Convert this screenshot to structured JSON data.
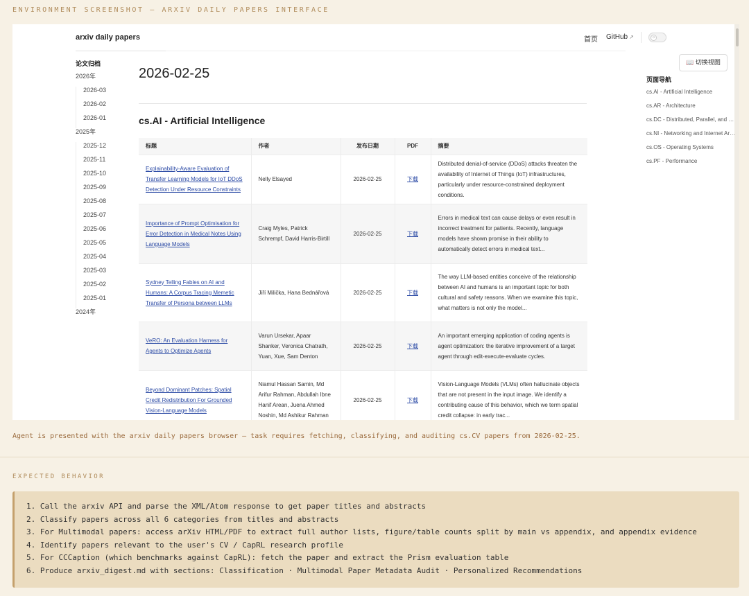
{
  "env_label": "ENVIRONMENT SCREENSHOT — ARXIV DAILY PAPERS INTERFACE",
  "header": {
    "app_title": "arxiv daily papers",
    "nav_home": "首页",
    "nav_github": "GitHub",
    "github_icon": "external-link-icon",
    "theme_icon": "sun-icon"
  },
  "sidebar": {
    "heading": "论文归档",
    "years": [
      {
        "label": "2026年",
        "months": [
          "2026-03",
          "2026-02",
          "2026-01"
        ]
      },
      {
        "label": "2025年",
        "months": [
          "2025-12",
          "2025-11",
          "2025-10",
          "2025-09",
          "2025-08",
          "2025-07",
          "2025-06",
          "2025-05",
          "2025-04",
          "2025-03",
          "2025-02",
          "2025-01"
        ]
      },
      {
        "label": "2024年",
        "months": []
      }
    ]
  },
  "main": {
    "date": "2026-02-25",
    "category_title": "cs.AI - Artificial Intelligence",
    "columns": [
      "标题",
      "作者",
      "发布日期",
      "PDF",
      "摘要"
    ],
    "rows": [
      {
        "title": "Explainability-Aware Evaluation of Transfer Learning Models for IoT DDoS Detection Under Resource Constraints",
        "authors": "Nelly Elsayed",
        "date": "2026-02-25",
        "pdf": "下载",
        "abstract": "Distributed denial-of-service (DDoS) attacks threaten the availability of Internet of Things (IoT) infrastructures, particularly under resource-constrained deployment conditions."
      },
      {
        "title": "Importance of Prompt Optimisation for Error Detection in Medical Notes Using Language Models",
        "authors": "Craig Myles, Patrick Schrempf, David Harris-Birtill",
        "date": "2026-02-25",
        "pdf": "下载",
        "abstract": "Errors in medical text can cause delays or even result in incorrect treatment for patients. Recently, language models have shown promise in their ability to automatically detect errors in medical text..."
      },
      {
        "title": "Sydney Telling Fables on AI and Humans: A Corpus Tracing Memetic Transfer of Persona between LLMs",
        "authors": "Jiří Milička, Hana Bednářová",
        "date": "2026-02-25",
        "pdf": "下载",
        "abstract": "The way LLM-based entities conceive of the relationship between AI and humans is an important topic for both cultural and safety reasons. When we examine this topic, what matters is not only the model..."
      },
      {
        "title": "VeRO: An Evaluation Harness for Agents to Optimize Agents",
        "authors": "Varun Ursekar, Apaar Shanker, Veronica Chatrath, Yuan, Xue, Sam Denton",
        "date": "2026-02-25",
        "pdf": "下载",
        "abstract": "An important emerging application of coding agents is agent optimization: the iterative improvement of a target agent through edit-execute-evaluate cycles."
      },
      {
        "title": "Beyond Dominant Patches: Spatial Credit Redistribution For Grounded Vision-Language Models",
        "authors": "Niamul Hassan Samin, Md Arifur Rahman, Abdullah Ibne Hanif Arean, Juena Ahmed Noshin, Md Ashikur Rahman",
        "date": "2026-02-25",
        "pdf": "下载",
        "abstract": "Vision-Language Models (VLMs) often hallucinate objects that are not present in the input image. We identify a contributing cause of this behavior, which we term spatial credit collapse: in early trac..."
      }
    ]
  },
  "right_panel": {
    "switch_view": "切换视图",
    "switch_icon": "book-icon",
    "toc_heading": "页面导航",
    "toc_items": [
      "cs.AI - Artificial Intelligence",
      "cs.AR - Architecture",
      "cs.DC - Distributed, Parallel, and Cluster Computing",
      "cs.NI - Networking and Internet Architecture",
      "cs.OS - Operating Systems",
      "cs.PF - Performance"
    ]
  },
  "caption": "Agent is presented with the arxiv daily papers browser — task requires fetching, classifying, and auditing cs.CV papers from 2026-02-25.",
  "expected": {
    "label": "EXPECTED BEHAVIOR",
    "steps": [
      "1. Call the arxiv API and parse the XML/Atom response to get paper titles and abstracts",
      "2. Classify papers across all 6 categories from titles and abstracts",
      "3. For Multimodal papers: access arXiv HTML/PDF to extract full author lists, figure/table counts split by main vs appendix, and appendix evidence",
      "4. Identify papers relevant to the user's CV / CapRL research profile",
      "5. For CCCaption (which benchmarks against CapRL): fetch the paper and extract the Prism evaluation table",
      "6. Produce arxiv_digest.md with sections: Classification · Multimodal Paper Metadata Audit · Personalized Recommendations"
    ]
  },
  "colors": {
    "page_bg": "#f7f1e5",
    "accent_text": "#9a6a3c",
    "link": "#2b4aa5",
    "expected_box": "#ebdcc0"
  }
}
